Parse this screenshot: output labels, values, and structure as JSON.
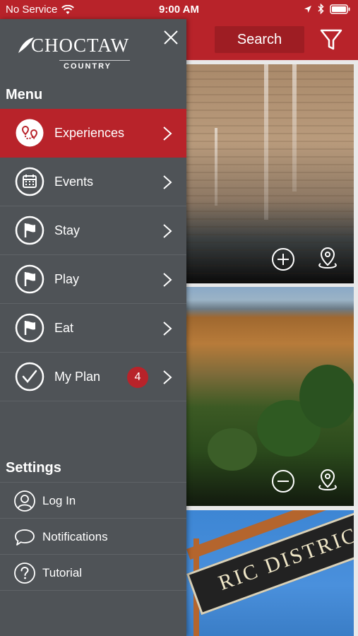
{
  "status_bar": {
    "carrier": "No Service",
    "time": "9:00 AM"
  },
  "header": {
    "search_label": "Search"
  },
  "drawer": {
    "logo_word": "CHOCTAW",
    "logo_sub": "COUNTRY",
    "menu_title": "Menu",
    "menu_items": [
      {
        "label": "Experiences",
        "icon": "map-route-icon",
        "active": true
      },
      {
        "label": "Events",
        "icon": "calendar-icon",
        "active": false
      },
      {
        "label": "Stay",
        "icon": "flag-icon",
        "active": false
      },
      {
        "label": "Play",
        "icon": "flag-icon",
        "active": false
      },
      {
        "label": "Eat",
        "icon": "flag-icon",
        "active": false
      },
      {
        "label": "My Plan",
        "icon": "checkmark-icon",
        "active": false,
        "badge": "4"
      }
    ],
    "settings_title": "Settings",
    "settings_items": [
      {
        "label": "Log In",
        "icon": "user-icon"
      },
      {
        "label": "Notifications",
        "icon": "speech-bubble-icon"
      },
      {
        "label": "Tutorial",
        "icon": "question-icon"
      }
    ]
  },
  "cards": [
    {
      "name": "waterfall-wall",
      "action": "add-icon"
    },
    {
      "name": "autumn-mountains",
      "action": "remove-icon"
    },
    {
      "name": "historic-district-sign",
      "sign_text": "RIC DISTRICT"
    }
  ],
  "colors": {
    "brand_red": "#b8232a",
    "drawer_bg": "#4f5357"
  }
}
